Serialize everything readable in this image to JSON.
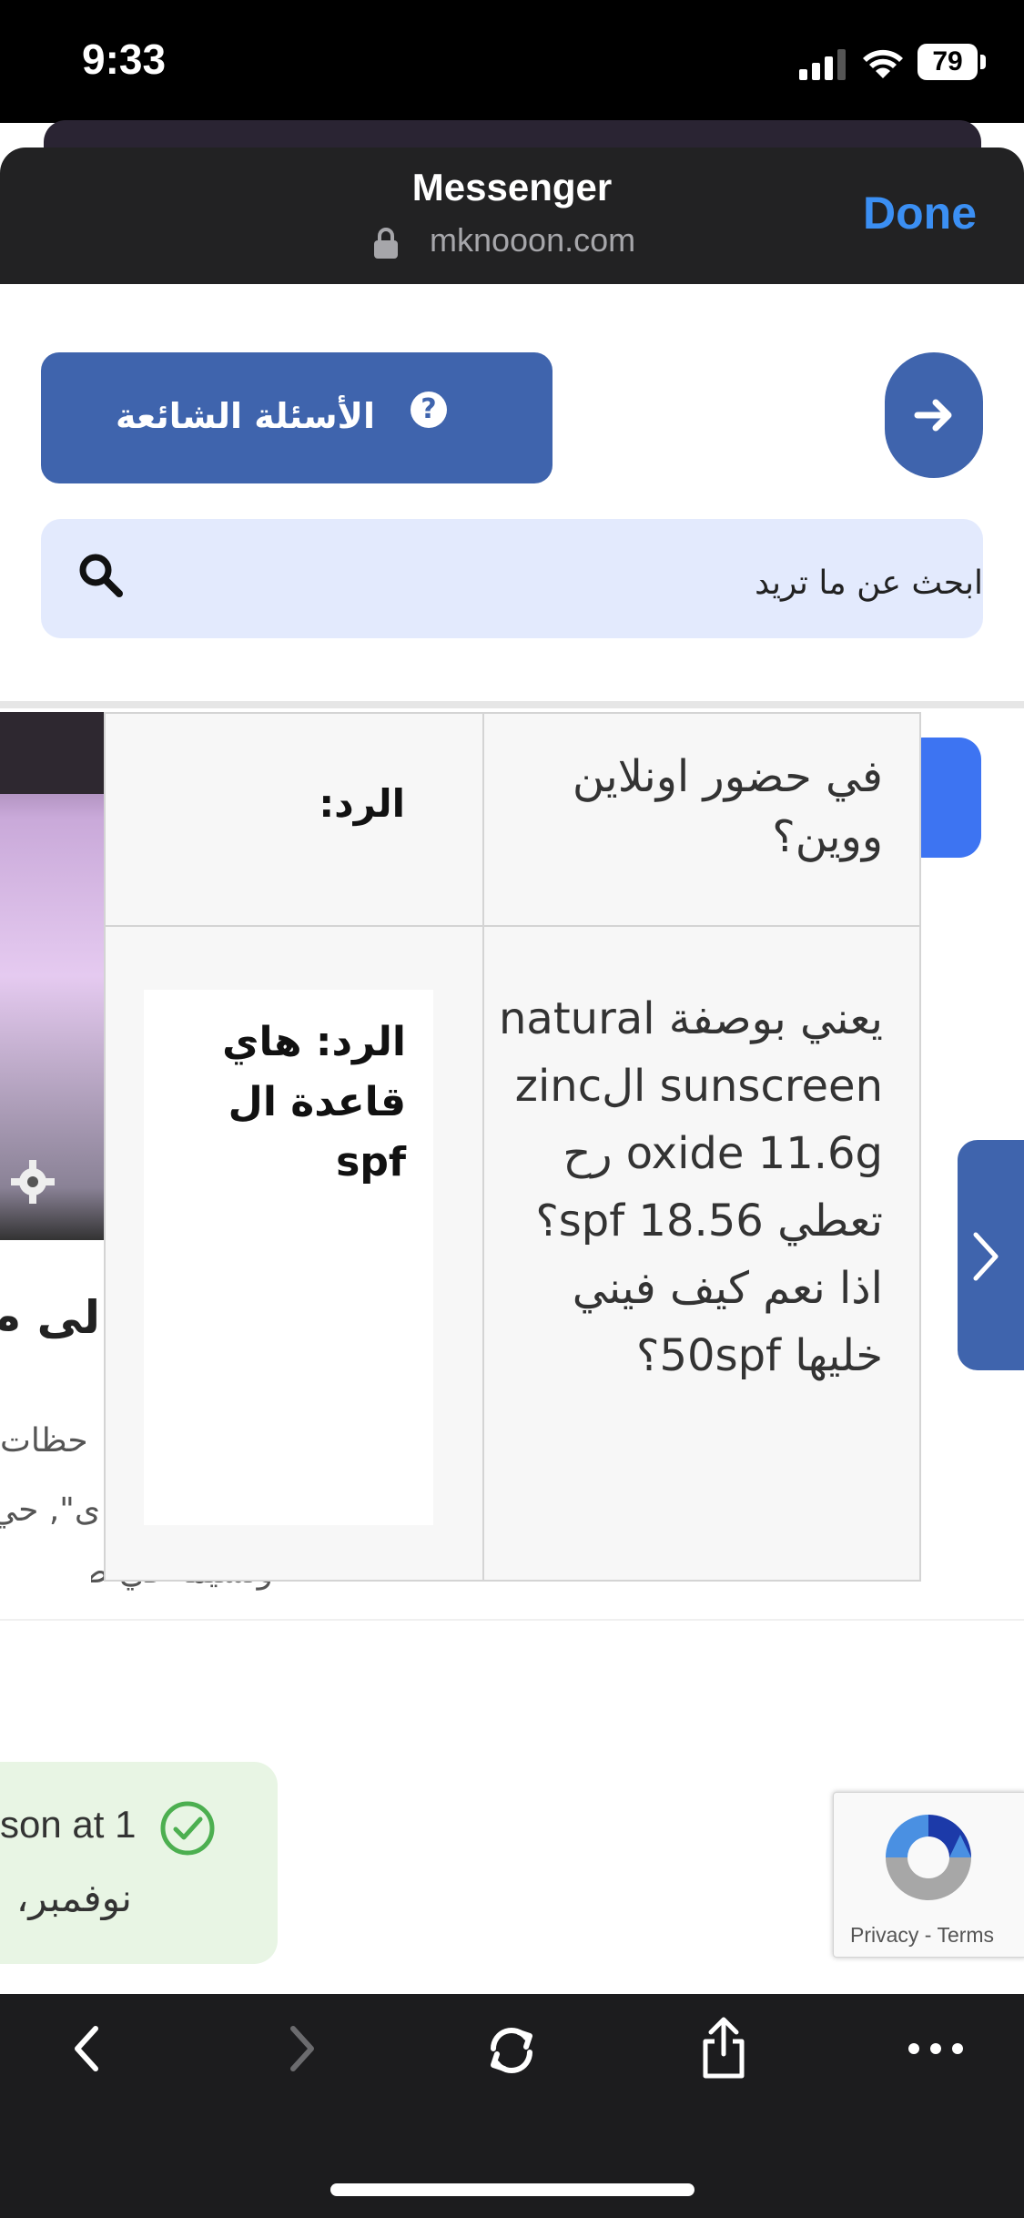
{
  "status_bar": {
    "time": "9:33",
    "battery": "79"
  },
  "sheet": {
    "title": "Messenger",
    "domain": "mknooon.com",
    "done_label": "Done"
  },
  "page": {
    "faq_button_label": "الأسئلة الشائعة",
    "faq_icon": "?",
    "search_placeholder": "ابحث عن ما تريد",
    "background_heading": "لى م",
    "background_line1": "حظات",
    "background_line2": "ى\", حي",
    "background_line3": "وتسيمه في صنا"
  },
  "table": {
    "rows": [
      {
        "question": "في حضور اونلاين ووين؟",
        "answer": "الرد:"
      },
      {
        "question": "يعني بوصفة natural sunscreen الzinc oxide 11.6g رح تعطي spf 18.56؟ اذا نعم كيف فيني خليها 50spf؟",
        "answer": "الرد: هاي قاعدة ال spf"
      }
    ]
  },
  "toast": {
    "line1": "son at 1",
    "line2": "نوفمبر،"
  },
  "recaptcha": {
    "privacy": "Privacy",
    "separator": " - ",
    "terms": "Terms"
  },
  "colors": {
    "primary": "#3f64ad",
    "accent_blue": "#3b8ff3",
    "toolbar": "#1c1c1e",
    "success": "#4caf50"
  }
}
